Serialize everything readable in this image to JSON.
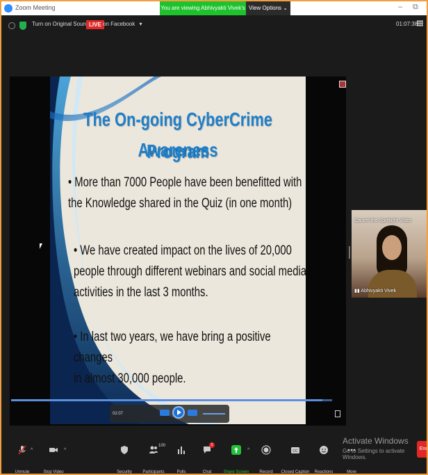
{
  "window": {
    "title": "Zoom Meeting",
    "viewing_banner": "You are viewing Abhivyakti Vivek's screen",
    "view_options": "View Options ⌄",
    "minimize": "–",
    "restore": "⧉"
  },
  "topbar": {
    "sound_button": "Turn on Original Sound",
    "sound_caret": "▾",
    "live_badge": "LIVE",
    "facebook_button": "on Facebook",
    "facebook_caret": "▾",
    "timer": "01:07:38"
  },
  "slide": {
    "title_line1": "The On-going CyberCrime Awareness",
    "title_line2": "Program",
    "bullets": [
      {
        "line1": "•  More than 7000 People have been benefitted with",
        "line2": "the Knowledge shared in the Quiz (in one month)"
      },
      {
        "line1": "•  We have created  impact on the lives of 20,000",
        "line2": "people through different webinars and social media",
        "line3": "activities in the last 3 months."
      },
      {
        "line1": "•  In  last two years, we have bring a  positive changes",
        "line2": "in almost 30,000 people."
      }
    ]
  },
  "player": {
    "time": "02:07",
    "progress": 0.97
  },
  "speaker": {
    "caption": "Cancel the Spotlight Video",
    "name": "Abhivyakti Vivek"
  },
  "watermark": {
    "title": "Activate Windows",
    "subtitle": "Go to Settings to activate Windows."
  },
  "toolbar": {
    "items": [
      {
        "label": "Unmute",
        "icon": "mic-muted-icon"
      },
      {
        "label": "Stop Video",
        "icon": "video-camera-icon"
      },
      {
        "label": "Security",
        "icon": "shield-icon"
      },
      {
        "label": "Participants",
        "icon": "participants-icon",
        "count": "100"
      },
      {
        "label": "Polls",
        "icon": "polls-icon"
      },
      {
        "label": "Chat",
        "icon": "chat-icon",
        "badge": "2"
      },
      {
        "label": "Share Screen",
        "icon": "share-screen-icon"
      },
      {
        "label": "Record",
        "icon": "record-icon"
      },
      {
        "label": "Closed Caption",
        "icon": "cc-icon"
      },
      {
        "label": "Reactions",
        "icon": "reactions-icon"
      },
      {
        "label": "More",
        "icon": "more-icon"
      }
    ],
    "caret": "^",
    "end_label": "End",
    "share_color": "#23c23a",
    "end_color": "#e02828"
  }
}
